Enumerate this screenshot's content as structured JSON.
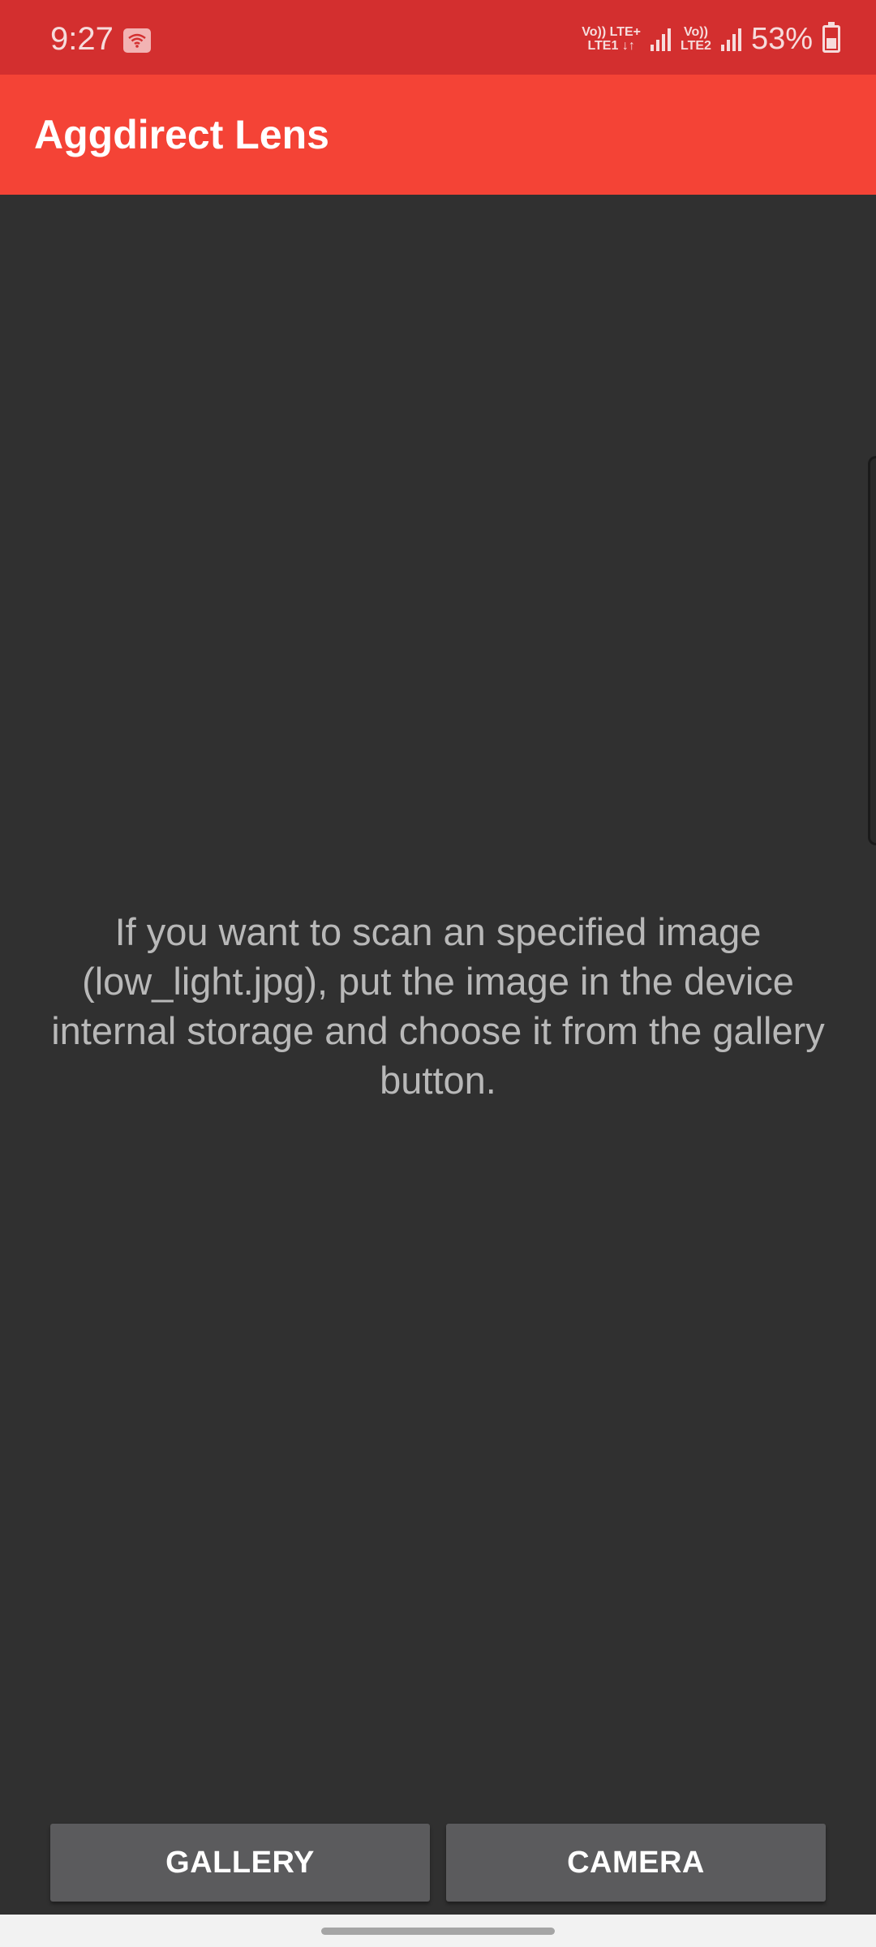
{
  "status_bar": {
    "time": "9:27",
    "wifi_icon": "wifi-hotspot-icon",
    "sim1_top": "Vo)) LTE+",
    "sim1_bottom": "LTE1 ↓↑",
    "sim2_top": "Vo))",
    "sim2_bottom": "LTE2",
    "battery_percent": "53%",
    "battery_icon": "battery-charging-icon"
  },
  "app_bar": {
    "title": "Aggdirect Lens"
  },
  "main": {
    "message": "If you want to scan an specified image (low_light.jpg), put the image in the device internal storage and choose it from the gallery button."
  },
  "buttons": {
    "gallery_label": "GALLERY",
    "camera_label": "CAMERA"
  },
  "colors": {
    "status_bar": "#d32f2f",
    "app_bar": "#f44336",
    "background": "#303030",
    "button": "#5b5b5d",
    "message_text": "#b8b8b8"
  }
}
